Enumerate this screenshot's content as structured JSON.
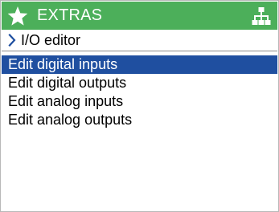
{
  "header": {
    "title": "EXTRAS",
    "left_icon": "star-icon",
    "right_icon": "network-icon",
    "color": "#4caf5a"
  },
  "breadcrumb": {
    "icon": "chevron-right-icon",
    "label": "I/O editor",
    "chevron_color": "#1f4fa0"
  },
  "menu": {
    "selected_index": 0,
    "selection_color": "#1f4fa0",
    "items": [
      {
        "label": "Edit digital inputs"
      },
      {
        "label": "Edit digital outputs"
      },
      {
        "label": "Edit analog inputs"
      },
      {
        "label": "Edit analog outputs"
      }
    ]
  }
}
